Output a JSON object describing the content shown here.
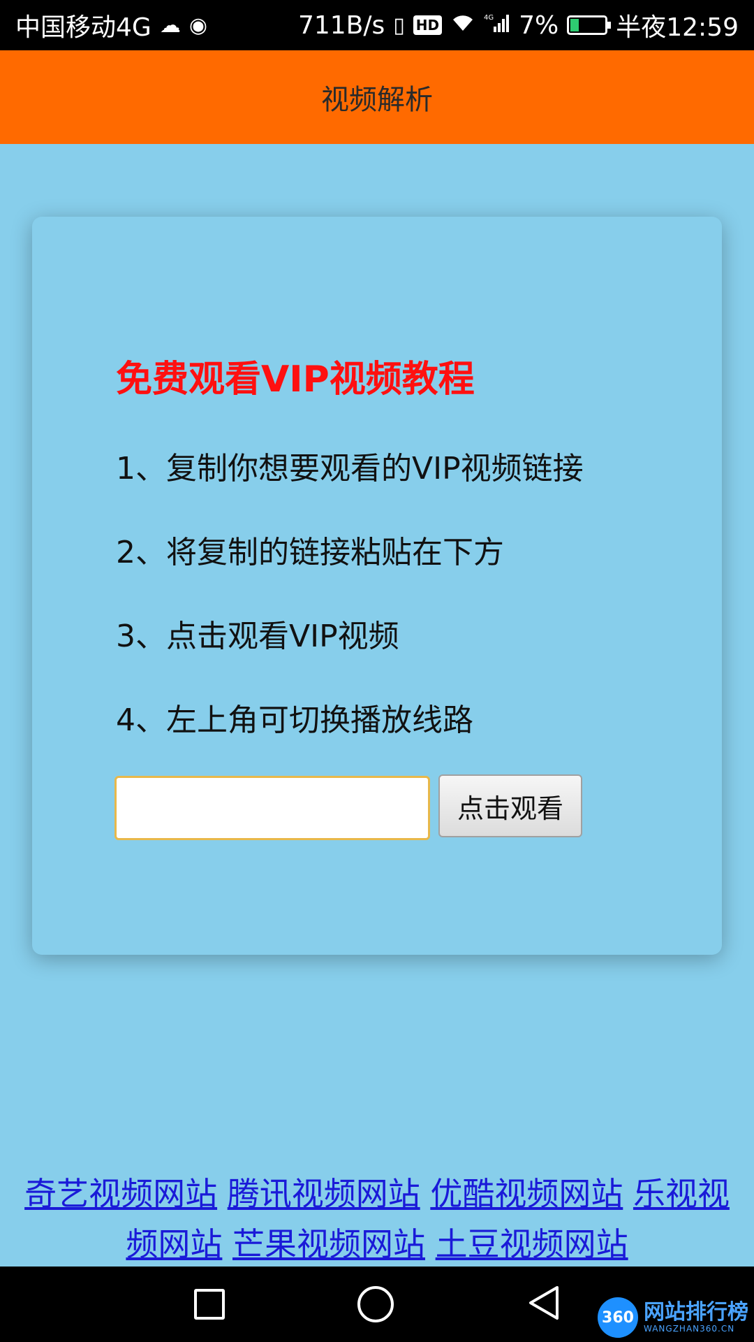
{
  "status_bar": {
    "carrier": "中国移动4G",
    "speed": "711B/s",
    "hd": "HD",
    "network": "4G",
    "battery": "7%",
    "time": "半夜12:59"
  },
  "header": {
    "title": "视频解析"
  },
  "card": {
    "heading": "免费观看VIP视频教程",
    "steps": [
      "1、复制你想要观看的VIP视频链接",
      "2、将复制的链接粘贴在下方",
      "3、点击观看VIP视频",
      "4、左上角可切换播放线路"
    ],
    "input": {
      "value": "",
      "placeholder": ""
    },
    "button_label": "点击观看"
  },
  "footer_links": [
    "奇艺视频网站",
    "腾讯视频网站",
    "优酷视频网站",
    "乐视视频网站",
    "芒果视频网站",
    "土豆视频网站"
  ],
  "watermark": {
    "logo": "360",
    "text": "网站排行榜",
    "sub": "WANGZHAN360.CN"
  },
  "colors": {
    "background": "#87CEEB",
    "header": "#FF6A00",
    "heading": "#FF1010",
    "link": "#1A1AD8"
  }
}
